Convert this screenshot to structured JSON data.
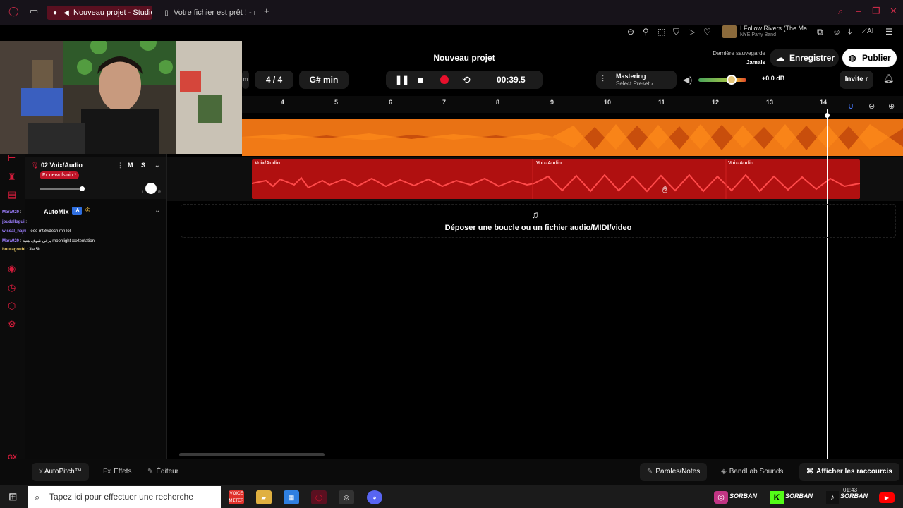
{
  "browser": {
    "tabs": [
      {
        "label": "Nouveau projet - Studio"
      },
      {
        "label": "Votre fichier est prêt ! - no"
      }
    ],
    "music": {
      "title": "I Follow Rivers (The Ma",
      "artist": "NYE Party Band"
    },
    "ai_label": "AI"
  },
  "header": {
    "project_title": "Nouveau projet",
    "last_save_label": "Dernière sauvegarde",
    "last_save_value": "Jamais",
    "save_button": "Enregistrer",
    "publish_button": "Publier"
  },
  "transport": {
    "bpm_fragment": "m",
    "time_signature": "4 / 4",
    "key": "G# min",
    "time": "00:39.5",
    "mastering_title": "Mastering",
    "mastering_preset": "Select Preset ›",
    "volume_db": "+0.0 dB",
    "invite_button": "Invite r",
    "volume_level": 0.7
  },
  "ruler": [
    "4",
    "5",
    "6",
    "7",
    "8",
    "9",
    "10",
    "11",
    "12",
    "13",
    "14"
  ],
  "track": {
    "number": "02",
    "name": "Voix/Audio",
    "fx": "Fx nervofsinin *",
    "mute": "M",
    "solo": "S",
    "pan_l": "L",
    "pan_r": "R",
    "clips": [
      "Voix/Audio",
      "Voix/Audio",
      "Voix/Audio"
    ]
  },
  "automix": {
    "label": "AutoMix",
    "badge": "IA"
  },
  "chat": [
    {
      "user": "Mara920",
      "text": ":"
    },
    {
      "user": "joudallagui",
      "text": ":"
    },
    {
      "user": "wissal_hajri",
      "text": ": leee mt3wdech mn lol"
    },
    {
      "user": "Mara920",
      "text": ": يرقى شوف هتية moonlight xxxtentation"
    },
    {
      "user": "houragoubi",
      "text": ": 3la 5ir"
    }
  ],
  "dropzone": {
    "text": "Déposer une boucle ou un fichier audio/MIDI/video"
  },
  "bottom": {
    "autopitch": "AutoPitch™",
    "effects": "Effets",
    "editor": "Éditeur",
    "lyrics": "Paroles/Notes",
    "sounds": "BandLab Sounds",
    "shortcuts": "Afficher les raccourcis",
    "gx": "GX"
  },
  "taskbar": {
    "search_placeholder": "Tapez ici pour effectuer une recherche",
    "clock": "01:43",
    "brand": "SORBAN"
  },
  "colors": {
    "accent": "#e8102c",
    "master_wave": "#e85c10",
    "clip": "#b01010"
  }
}
